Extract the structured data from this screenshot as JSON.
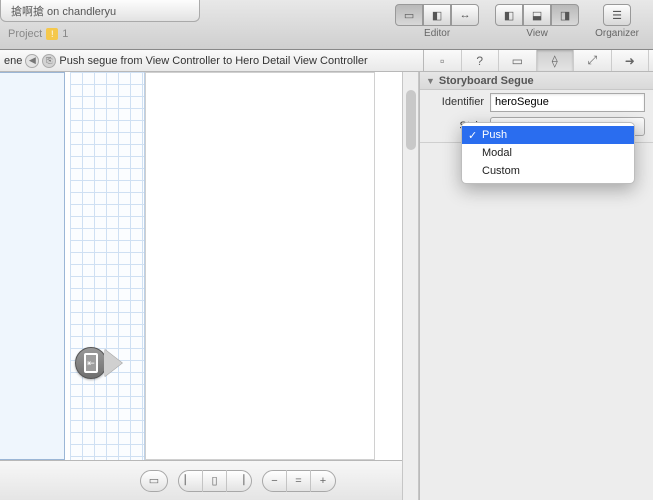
{
  "project_tab": {
    "title": "搶啊搶 on chandleryu",
    "subtitle": "Project",
    "warn_count": "1"
  },
  "toolbar_groups": {
    "editor": "Editor",
    "view": "View",
    "organizer": "Organizer"
  },
  "pathbar": {
    "left_fragment": "ene",
    "segue_text": "Push segue from View Controller to Hero Detail View Controller"
  },
  "inspector": {
    "section_title": "Storyboard Segue",
    "identifier_label": "Identifier",
    "identifier_value": "heroSegue",
    "style_label": "Style",
    "style_options": [
      "Push",
      "Modal",
      "Custom"
    ],
    "style_selected": "Push"
  }
}
